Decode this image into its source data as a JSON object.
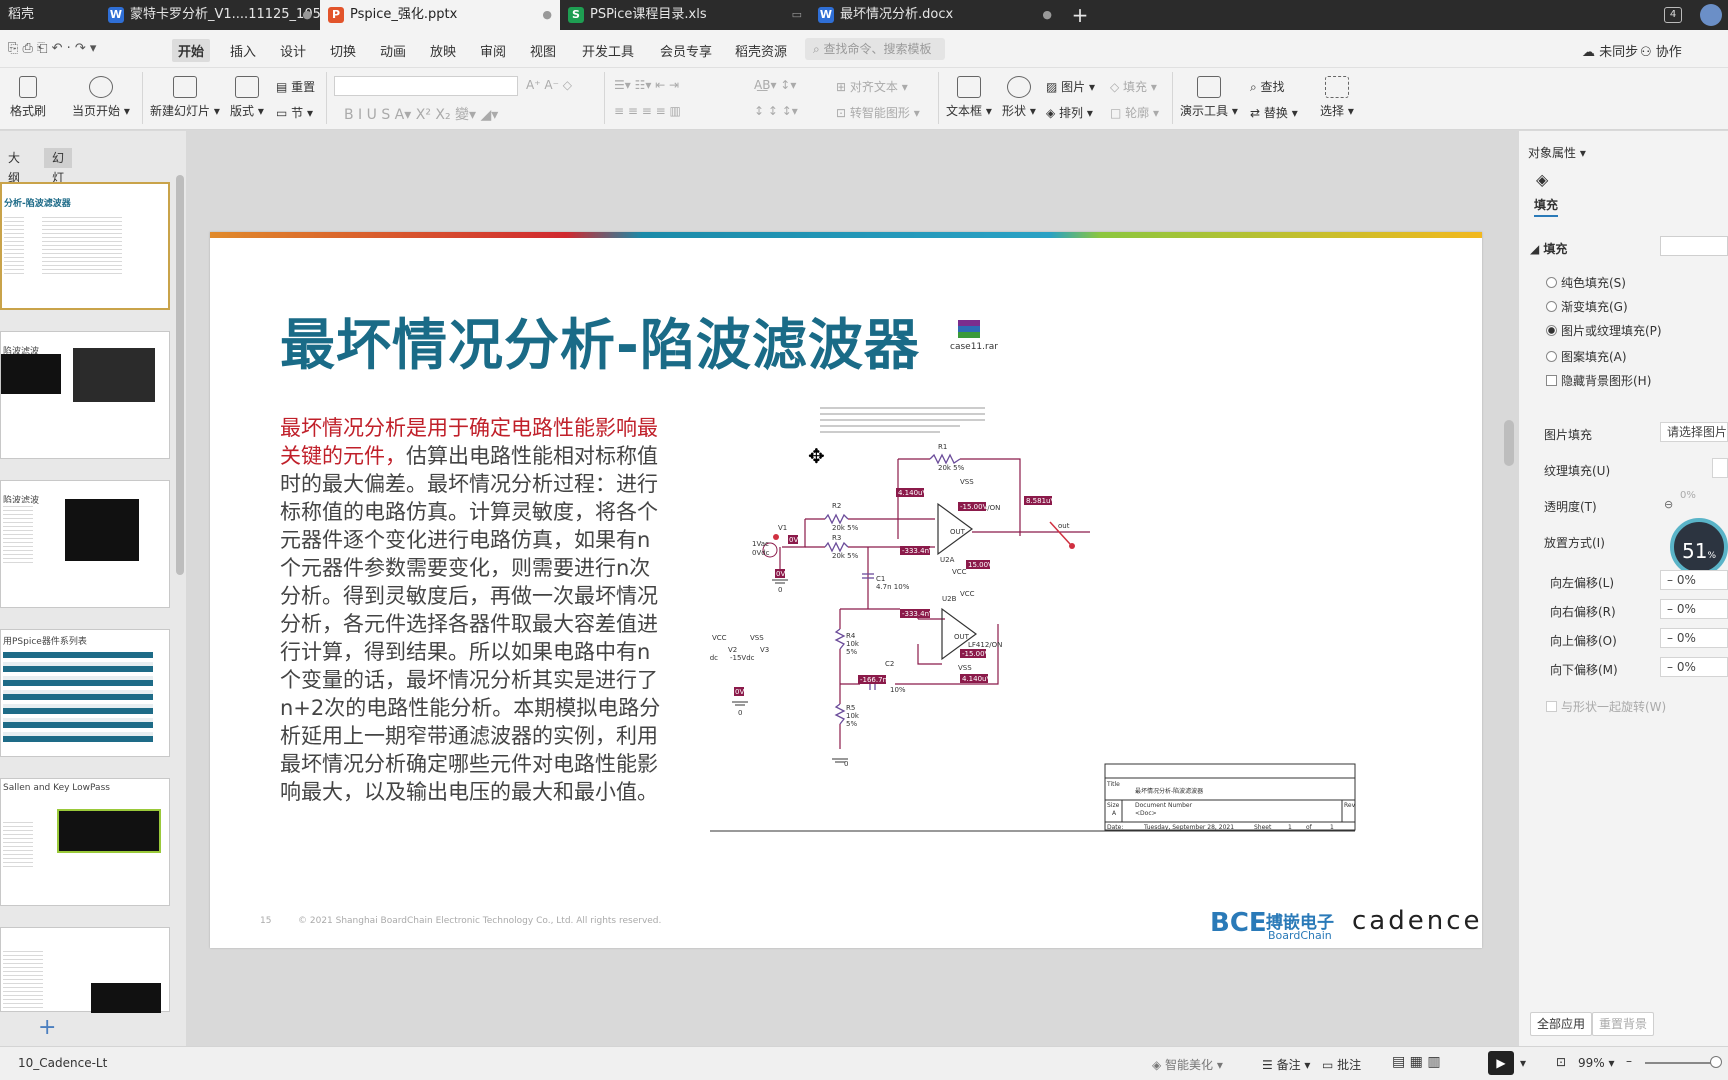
{
  "tabs": [
    {
      "label": "稻壳",
      "active": false
    },
    {
      "label": "蒙特卡罗分析_V1....11125_1051",
      "active": false,
      "icon": "W"
    },
    {
      "label": "Pspice_强化.pptx",
      "active": true,
      "icon": "P"
    },
    {
      "label": "PSPice课程目录.xls",
      "active": false,
      "icon": "S"
    },
    {
      "label": "最坏情况分析.docx",
      "active": false,
      "icon": "W"
    }
  ],
  "tab_count": "4",
  "menu": {
    "items": [
      "开始",
      "插入",
      "设计",
      "切换",
      "动画",
      "放映",
      "审阅",
      "视图",
      "开发工具",
      "会员专享",
      "稻壳资源"
    ],
    "search_placeholder": "查找命令、搜索模板",
    "sync": "未同步",
    "collab": "协作"
  },
  "ribbon": {
    "format_painter": "格式刷",
    "play_current": "当页开始",
    "new_slide": "新建幻灯片",
    "layout": "版式",
    "section": "节",
    "reset": "重置",
    "align_text": "对齐文本",
    "to_smartart": "转智能图形",
    "textbox": "文本框",
    "shape": "形状",
    "picture": "图片",
    "arrange": "排列",
    "fill": "填充",
    "outline": "轮廓",
    "presentation_tools": "演示工具",
    "find": "查找",
    "replace": "替换",
    "select": "选择"
  },
  "left_panel": {
    "tab_outline": "大纲",
    "tab_slides": "幻灯片",
    "thumbs": [
      "分析-陷波滤波器",
      "陷波滤波",
      "陷波滤波",
      "用PSpice器件系列表",
      "Sallen and Key LowPass",
      ""
    ]
  },
  "slide": {
    "title": "最坏情况分析-陷波滤波器",
    "attachment": "case11.rar",
    "body_red": "最坏情况分析是用于确定电路性能影响最关键的元件，",
    "body_rest": "估算出电路性能相对标称值时的最大偏差。最坏情况分析过程：进行标称值的电路仿真。计算灵敏度，将各个元器件逐个变化进行电路仿真，如果有n个元器件参数需要变化，则需要进行n次分析。得到灵敏度后，再做一次最坏情况分析，各元件选择各器件取最大容差值进行计算，得到结果。所以如果电路中有n个变量的话，最坏情况分析其实是进行了n+2次的电路性能分析。本期模拟电路分析延用上一期窄带通滤波器的实例，利用最坏情况分析确定哪些元件对电路性能影响最大，以及输出电压的最大和最小值。",
    "page_no": "15",
    "copyright": "© 2021 Shanghai BoardChain Electronic Technology Co., Ltd. All rights reserved.",
    "logo_bce": "BCE",
    "logo_cn": "搏嵌电子",
    "logo_en": "BoardChain",
    "logo_cadence": "cadence",
    "schematic": {
      "r1": "R1",
      "r1v": "20k 5%",
      "r2": "R2",
      "r2v": "20k 5%",
      "r3": "R3",
      "r3v": "20k 5%",
      "r4": "R4",
      "r4v": "10k",
      "r4t": "5%",
      "r5": "R5",
      "r5v": "10k",
      "r5t": "5%",
      "c1": "C1",
      "c1v": "4.7n 10%",
      "c2": "C2",
      "c2v": "10%",
      "v1": "V1",
      "v1v": "1Vac",
      "v1d": "0Vdc",
      "v2": "V2",
      "v3": "V3",
      "vcc": "VCC",
      "vss": "VSS",
      "v15": "15Vdc",
      "vm15": "-15Vdc",
      "u2a": "U2A",
      "u2b": "U2B",
      "op": "LF412/ON",
      "out": "OUT",
      "outlbl": "out",
      "zero": "0",
      "p1": "4.140uV",
      "p2": "-15.00V",
      "p3": "8.581uV",
      "p4": "-333.4nV",
      "p5": "15.00V",
      "p6": "-333.4nV",
      "p7": "-166.7nV",
      "p8": "4.140uV",
      "p9": "0V",
      "p10": "0V",
      "p11": "0V",
      "p12": "-15.00V",
      "tb_title_lbl": "Title",
      "tb_title": "最坏情况分析-陷波滤波器",
      "tb_size": "Size",
      "tb_size_v": "A",
      "tb_doc": "Document Number",
      "tb_doc_v": "<Doc>",
      "tb_rev": "Rev",
      "tb_date": "Date:",
      "tb_date_v": "Tuesday, September 28, 2021",
      "tb_sheet": "Sheet",
      "tb_sheet_v": "1",
      "tb_of": "of",
      "tb_of_v": "1"
    }
  },
  "right_panel": {
    "header": "对象属性",
    "tab_fill": "填充",
    "section_fill": "填充",
    "opt_solid": "纯色填充(S)",
    "opt_gradient": "渐变填充(G)",
    "opt_picture": "图片或纹理填充(P)",
    "opt_pattern": "图案填充(A)",
    "opt_hide_bg": "隐藏背景图形(H)",
    "pic_fill": "图片填充",
    "pic_fill_value": "请选择图片",
    "texture": "纹理填充(U)",
    "transparency": "透明度(T)",
    "transparency_value": "0%",
    "place": "放置方式(I)",
    "off_left": "向左偏移(L)",
    "off_right": "向右偏移(R)",
    "off_up": "向上偏移(O)",
    "off_down": "向下偏移(M)",
    "off_value": "0%",
    "rotate_with": "与形状一起旋转(W)",
    "apply_all": "全部应用",
    "reset_bg": "重置背景",
    "gauge_value": "51"
  },
  "status": {
    "slide_name": "10_Cadence-Lt",
    "beautify": "智能美化",
    "notes": "备注",
    "comment": "批注",
    "zoom": "99%"
  }
}
